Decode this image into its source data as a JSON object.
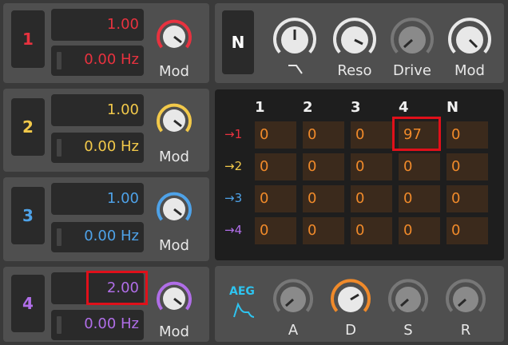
{
  "operators": [
    {
      "number": "1",
      "ratio": "1.00",
      "freq": "0.00 Hz",
      "mod_label": "Mod",
      "color": "#e8323f"
    },
    {
      "number": "2",
      "ratio": "1.00",
      "freq": "0.00 Hz",
      "mod_label": "Mod",
      "color": "#f2c94a"
    },
    {
      "number": "3",
      "ratio": "1.00",
      "freq": "0.00 Hz",
      "mod_label": "Mod",
      "color": "#4ea2e8"
    },
    {
      "number": "4",
      "ratio": "2.00",
      "freq": "0.00 Hz",
      "mod_label": "Mod",
      "color": "#b06ee8"
    }
  ],
  "filter": {
    "mode_label": "N",
    "knobs": [
      {
        "name": "cutoff",
        "label": ""
      },
      {
        "name": "reso",
        "label": "Reso"
      },
      {
        "name": "drive",
        "label": "Drive"
      },
      {
        "name": "mod",
        "label": "Mod"
      }
    ]
  },
  "matrix": {
    "columns": [
      "1",
      "2",
      "3",
      "4",
      "N"
    ],
    "rows": [
      {
        "label": "→1",
        "values": [
          "0",
          "0",
          "0",
          "97",
          "0"
        ]
      },
      {
        "label": "→2",
        "values": [
          "0",
          "0",
          "0",
          "0",
          "0"
        ]
      },
      {
        "label": "→3",
        "values": [
          "0",
          "0",
          "0",
          "0",
          "0"
        ]
      },
      {
        "label": "→4",
        "values": [
          "0",
          "0",
          "0",
          "0",
          "0"
        ]
      }
    ]
  },
  "envelope": {
    "title": "AEG",
    "knobs": [
      {
        "name": "attack",
        "label": "A"
      },
      {
        "name": "decay",
        "label": "D"
      },
      {
        "name": "sustain",
        "label": "S"
      },
      {
        "name": "release",
        "label": "R"
      }
    ]
  },
  "colors": {
    "accent_orange": "#f08a2a",
    "highlight_red": "#e0101a",
    "aeg_blue": "#2ec4f0"
  }
}
